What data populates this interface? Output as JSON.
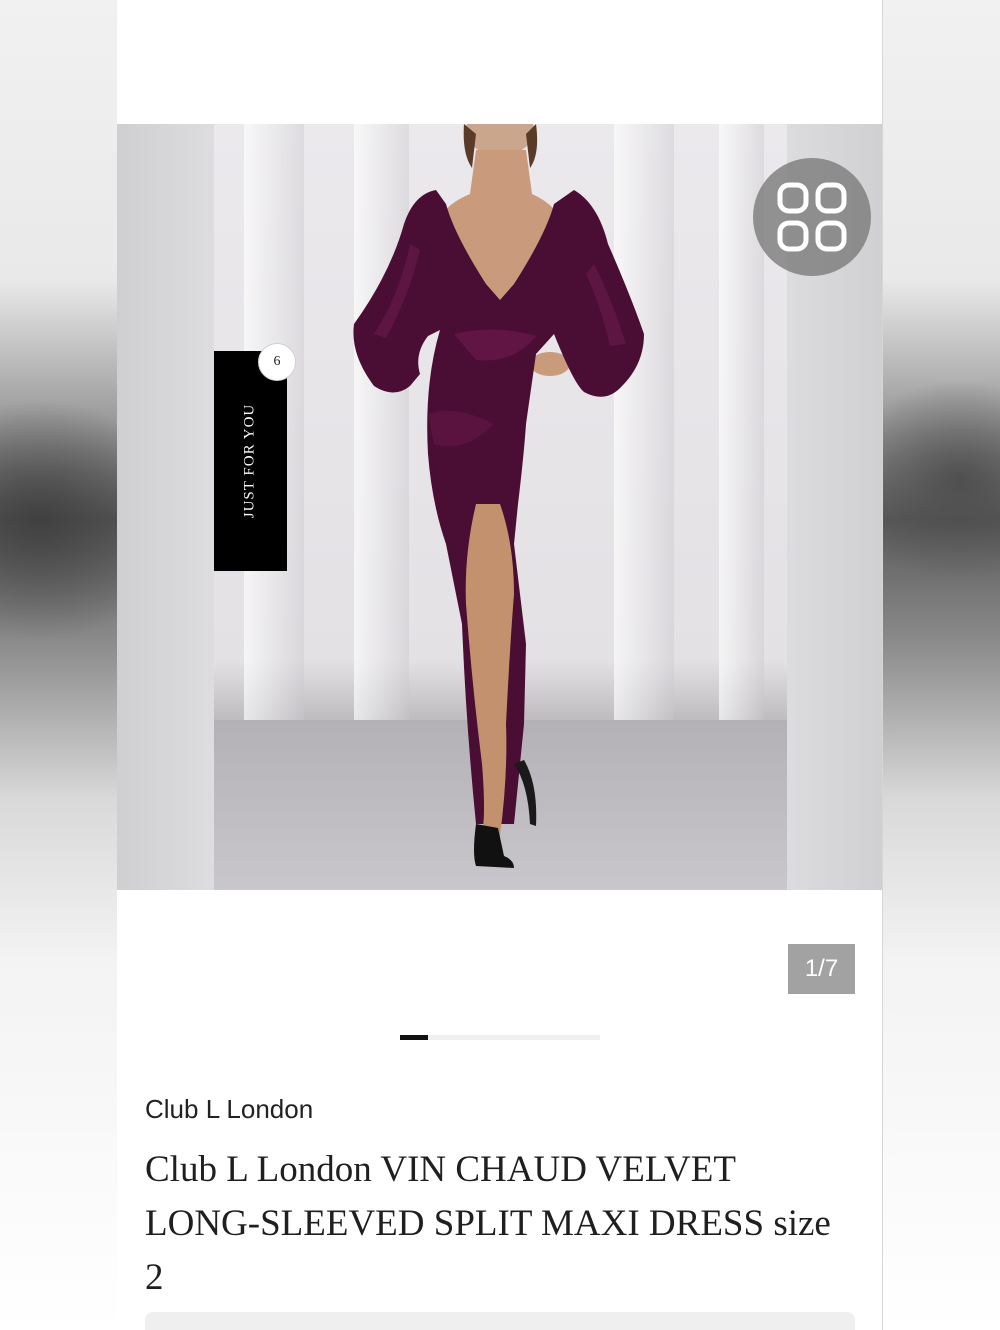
{
  "listing": {
    "badge_count": "6",
    "tab_label": "JUST FOR YOU",
    "image_counter": "1/7",
    "carousel_progress": 0.14,
    "brand": "Club L London",
    "title": "Club L London VIN CHAUD VELVET LONG-SLEEVED SPLIT MAXI DRESS size 2"
  },
  "icons": {
    "grid": "grid-view-icon"
  },
  "colors": {
    "dress": "#4a0d33",
    "tab_background": "#000000",
    "counter_background": "#a2a2a2",
    "progress_fill": "#111111"
  }
}
